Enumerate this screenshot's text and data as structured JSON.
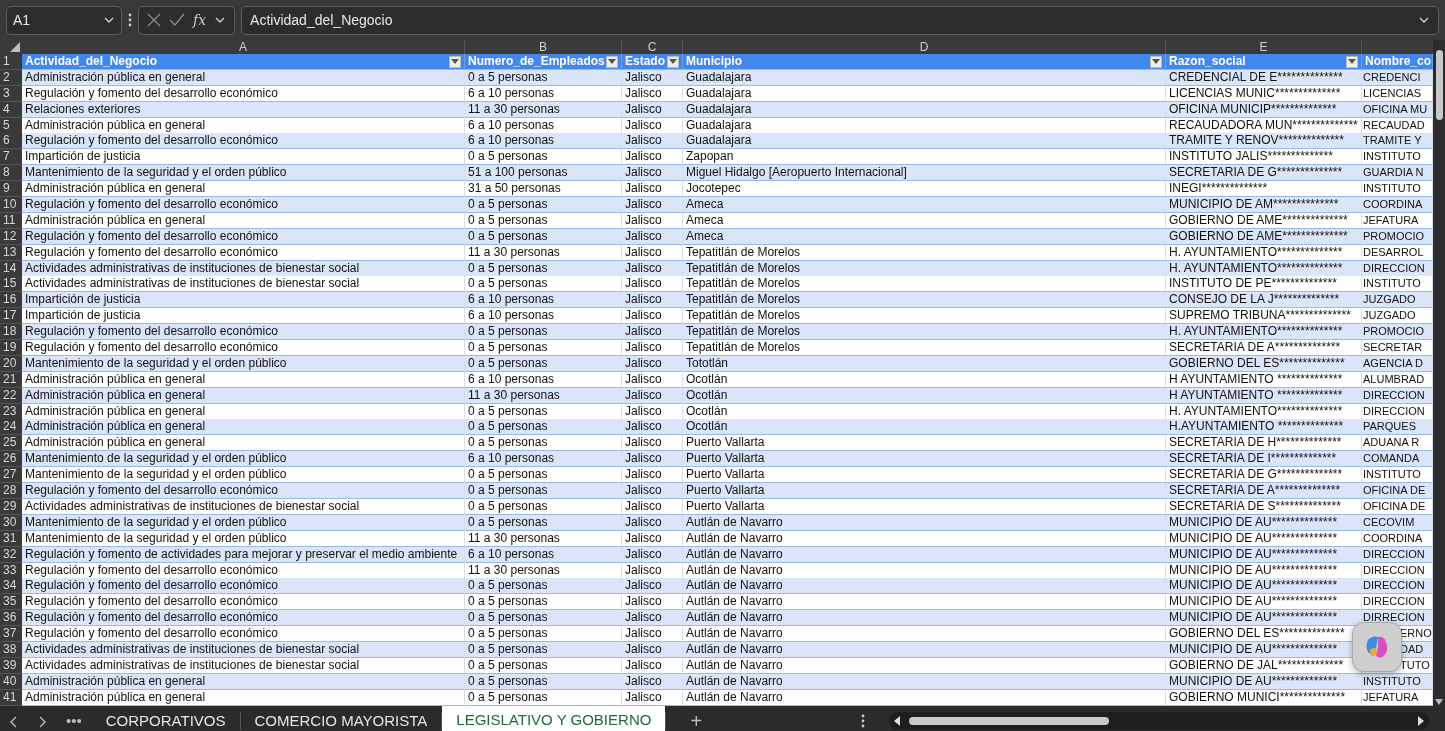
{
  "formula_bar": {
    "name_box": "A1",
    "fx": "fx",
    "formula": "Actividad_del_Negocio"
  },
  "column_letters": [
    "A",
    "B",
    "C",
    "D",
    "E"
  ],
  "columns": [
    {
      "header": "Actividad_del_Negocio",
      "filter": true
    },
    {
      "header": "Numero_de_Empleados",
      "filter": true
    },
    {
      "header": "Estado",
      "filter": true
    },
    {
      "header": "Municipio",
      "filter": true
    },
    {
      "header": "Razon_social",
      "filter": true
    },
    {
      "header": "Nombre_co",
      "filter": false
    }
  ],
  "header_row_number": "1",
  "rows": [
    {
      "number": "2",
      "cells": [
        "Administración pública en general",
        "0 a 5 personas",
        "Jalisco",
        "Guadalajara",
        "CREDENCIAL DE E**************",
        "CREDENCI"
      ]
    },
    {
      "number": "3",
      "cells": [
        "Regulación y fomento del desarrollo económico",
        "6 a 10 personas",
        "Jalisco",
        "Guadalajara",
        "LICENCIAS MUNIC**************",
        "LICENCIAS"
      ]
    },
    {
      "number": "4",
      "cells": [
        "Relaciones exteriores",
        "11 a 30 personas",
        "Jalisco",
        "Guadalajara",
        "OFICINA MUNICIP**************",
        "OFICINA MU"
      ]
    },
    {
      "number": "5",
      "cells": [
        "Administración pública en general",
        "6 a 10 personas",
        "Jalisco",
        "Guadalajara",
        "RECAUDADORA MUN**************",
        "RECAUDAD"
      ]
    },
    {
      "number": "6",
      "cells": [
        "Regulación y fomento del desarrollo económico",
        "6 a 10 personas",
        "Jalisco",
        "Guadalajara",
        "TRAMITE Y RENOV**************",
        "TRAMITE Y"
      ]
    },
    {
      "number": "7",
      "cells": [
        "Impartición de justicia",
        "0 a 5 personas",
        "Jalisco",
        "Zapopan",
        "INSTITUTO JALIS**************",
        "INSTITUTO"
      ]
    },
    {
      "number": "8",
      "cells": [
        "Mantenimiento de la seguridad y el orden público",
        "51 a 100 personas",
        "Jalisco",
        "Miguel Hidalgo [Aeropuerto Internacional]",
        "SECRETARIA DE G**************",
        "GUARDIA N"
      ]
    },
    {
      "number": "9",
      "cells": [
        "Administración pública en general",
        "31 a 50 personas",
        "Jalisco",
        "Jocotepec",
        "INEGI**************",
        "INSTITUTO"
      ]
    },
    {
      "number": "10",
      "cells": [
        "Regulación y fomento del desarrollo económico",
        "0 a 5 personas",
        "Jalisco",
        "Ameca",
        "MUNICIPIO DE AM**************",
        "COORDINA"
      ]
    },
    {
      "number": "11",
      "cells": [
        "Administración pública en general",
        "0 a 5 personas",
        "Jalisco",
        "Ameca",
        "GOBIERNO DE AME**************",
        "JEFATURA"
      ]
    },
    {
      "number": "12",
      "cells": [
        "Regulación y fomento del desarrollo económico",
        "0 a 5 personas",
        "Jalisco",
        "Ameca",
        "GOBIERNO DE AME**************",
        "PROMOCIO"
      ]
    },
    {
      "number": "13",
      "cells": [
        "Regulación y fomento del desarrollo económico",
        "11 a 30 personas",
        "Jalisco",
        "Tepatitlán de Morelos",
        "H. AYUNTAMIENTO**************",
        "DESARROL"
      ]
    },
    {
      "number": "14",
      "cells": [
        "Actividades administrativas de instituciones de bienestar social",
        "0 a 5 personas",
        "Jalisco",
        "Tepatitlán de Morelos",
        "H. AYUNTAMIENTO**************",
        "DIRECCION"
      ]
    },
    {
      "number": "15",
      "cells": [
        "Actividades administrativas de instituciones de bienestar social",
        "0 a 5 personas",
        "Jalisco",
        "Tepatitlán de Morelos",
        "INSTITUTO DE PE**************",
        "INSTITUTO"
      ]
    },
    {
      "number": "16",
      "cells": [
        "Impartición de justicia",
        "6 a 10 personas",
        "Jalisco",
        "Tepatitlán de Morelos",
        "CONSEJO DE LA J**************",
        "JUZGADO"
      ]
    },
    {
      "number": "17",
      "cells": [
        "Impartición de justicia",
        "6 a 10 personas",
        "Jalisco",
        "Tepatitlán de Morelos",
        "SUPREMO TRIBUNA**************",
        "JUZGADO"
      ]
    },
    {
      "number": "18",
      "cells": [
        "Regulación y fomento del desarrollo económico",
        "0 a 5 personas",
        "Jalisco",
        "Tepatitlán de Morelos",
        "H. AYUNTAMIENTO**************",
        "PROMOCIO"
      ]
    },
    {
      "number": "19",
      "cells": [
        "Regulación y fomento del desarrollo económico",
        "0 a 5 personas",
        "Jalisco",
        "Tepatitlán de Morelos",
        "SECRETARIA DE A**************",
        "SECRETAR"
      ]
    },
    {
      "number": "20",
      "cells": [
        "Mantenimiento de la seguridad y el orden público",
        "0 a 5 personas",
        "Jalisco",
        "Tototlán",
        "GOBIERNO DEL ES**************",
        "AGENCIA D"
      ]
    },
    {
      "number": "21",
      "cells": [
        "Administración pública en general",
        "6 a 10 personas",
        "Jalisco",
        "Ocotlán",
        "H AYUNTAMIENTO **************",
        "ALUMBRAD"
      ]
    },
    {
      "number": "22",
      "cells": [
        "Administración pública en general",
        "11 a 30 personas",
        "Jalisco",
        "Ocotlán",
        "H AYUNTAMIENTO **************",
        "DIRECCION"
      ]
    },
    {
      "number": "23",
      "cells": [
        "Administración pública en general",
        "0 a 5 personas",
        "Jalisco",
        "Ocotlán",
        "H. AYUNTAMIENTO**************",
        "DIRECCION"
      ]
    },
    {
      "number": "24",
      "cells": [
        "Administración pública en general",
        "0 a 5 personas",
        "Jalisco",
        "Ocotlán",
        "H.AYUNTAMIENTO **************",
        "PARQUES"
      ]
    },
    {
      "number": "25",
      "cells": [
        "Administración pública en general",
        "0 a 5 personas",
        "Jalisco",
        "Puerto Vallarta",
        "SECRETARIA DE H**************",
        "ADUANA R"
      ]
    },
    {
      "number": "26",
      "cells": [
        "Mantenimiento de la seguridad y el orden público",
        "6 a 10 personas",
        "Jalisco",
        "Puerto Vallarta",
        "SECRETARIA DE I**************",
        "COMANDA"
      ]
    },
    {
      "number": "27",
      "cells": [
        "Mantenimiento de la seguridad y el orden público",
        "0 a 5 personas",
        "Jalisco",
        "Puerto Vallarta",
        "SECRETARIA DE G**************",
        "INSTITUTO"
      ]
    },
    {
      "number": "28",
      "cells": [
        "Regulación y fomento del desarrollo económico",
        "0 a 5 personas",
        "Jalisco",
        "Puerto Vallarta",
        "SECRETARIA DE A**************",
        "OFICINA DE"
      ]
    },
    {
      "number": "29",
      "cells": [
        "Actividades administrativas de instituciones de bienestar social",
        "0 a 5 personas",
        "Jalisco",
        "Puerto Vallarta",
        "SECRETARIA DE S**************",
        "OFICINA DE"
      ]
    },
    {
      "number": "30",
      "cells": [
        "Mantenimiento de la seguridad y el orden público",
        "0 a 5 personas",
        "Jalisco",
        "Autlán de Navarro",
        "MUNICIPIO DE AU**************",
        "CECOVIM"
      ]
    },
    {
      "number": "31",
      "cells": [
        "Mantenimiento de la seguridad y el orden público",
        "11 a 30 personas",
        "Jalisco",
        "Autlán de Navarro",
        "MUNICIPIO DE AU**************",
        "COORDINA"
      ]
    },
    {
      "number": "32",
      "cells": [
        "Regulación y fomento de actividades para mejorar y preservar el medio ambiente",
        "6 a 10 personas",
        "Jalisco",
        "Autlán de Navarro",
        "MUNICIPIO DE AU**************",
        "DIRECCION"
      ]
    },
    {
      "number": "33",
      "cells": [
        "Regulación y fomento del desarrollo económico",
        "11 a 30 personas",
        "Jalisco",
        "Autlán de Navarro",
        "MUNICIPIO DE AU**************",
        "DIRECCION"
      ]
    },
    {
      "number": "34",
      "cells": [
        "Regulación y fomento del desarrollo económico",
        "0 a 5 personas",
        "Jalisco",
        "Autlán de Navarro",
        "MUNICIPIO DE AU**************",
        "DIRECCION"
      ]
    },
    {
      "number": "35",
      "cells": [
        "Regulación y fomento del desarrollo económico",
        "0 a 5 personas",
        "Jalisco",
        "Autlán de Navarro",
        "MUNICIPIO DE AU**************",
        "DIRECCION"
      ]
    },
    {
      "number": "36",
      "cells": [
        "Regulación y fomento del desarrollo económico",
        "0 a 5 personas",
        "Jalisco",
        "Autlán de Navarro",
        "MUNICIPIO DE AU**************",
        "DIRRECION"
      ]
    },
    {
      "number": "37",
      "cells": [
        "Regulación y fomento del desarrollo económico",
        "0 a 5 personas",
        "Jalisco",
        "Autlán de Navarro",
        "GOBIERNO DEL ES**************",
        "ERNO"
      ],
      "last_cell_covered": true
    },
    {
      "number": "38",
      "cells": [
        "Actividades administrativas de instituciones de bienestar social",
        "0 a 5 personas",
        "Jalisco",
        "Autlán de Navarro",
        "MUNICIPIO DE AU**************",
        "DAD"
      ],
      "last_cell_covered": true
    },
    {
      "number": "39",
      "cells": [
        "Actividades administrativas de instituciones de bienestar social",
        "0 a 5 personas",
        "Jalisco",
        "Autlán de Navarro",
        "GOBIERNO DE JAL**************",
        "TUTO"
      ],
      "last_cell_covered": true
    },
    {
      "number": "40",
      "cells": [
        "Administración pública en general",
        "0 a 5 personas",
        "Jalisco",
        "Autlán de Navarro",
        "MUNICIPIO DE AU**************",
        "INSTITUTO"
      ]
    },
    {
      "number": "41",
      "cells": [
        "Administración pública en general",
        "0 a 5 personas",
        "Jalisco",
        "Autlán de Navarro",
        "GOBIERNO MUNICI**************",
        "JEFATURA"
      ]
    }
  ],
  "sheet_nav": {
    "more": "•••",
    "add": "+"
  },
  "tabs": [
    {
      "label": "CORPORATIVOS",
      "selected": false
    },
    {
      "label": "COMERCIO MAYORISTA",
      "selected": false
    },
    {
      "label": "LEGISLATIVO Y GOBIERNO",
      "selected": true
    }
  ]
}
